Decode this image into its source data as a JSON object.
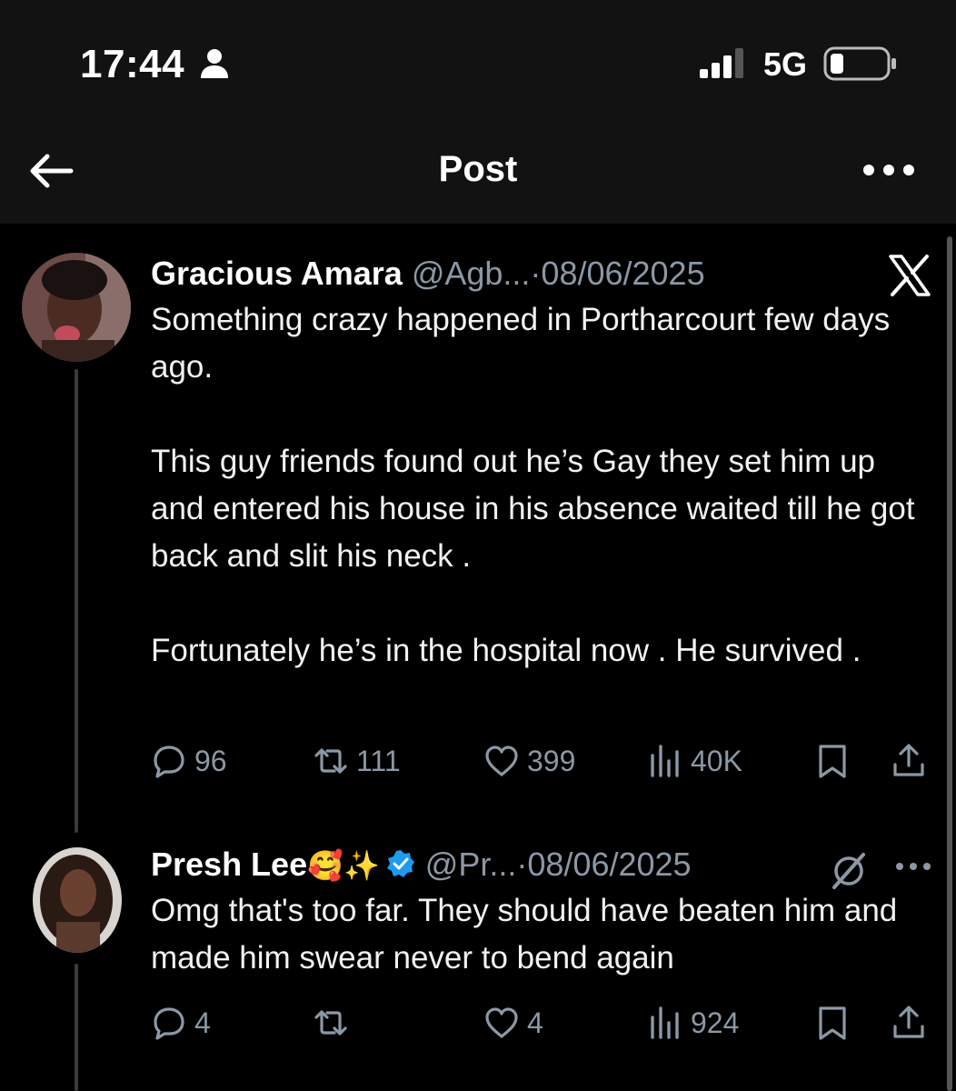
{
  "status_bar": {
    "time": "17:44",
    "network": "5G"
  },
  "nav": {
    "title": "Post"
  },
  "post": {
    "author_name": "Gracious Amara",
    "handle": "@Agb...",
    "separator": "·",
    "date": "08/06/2025",
    "text": "Something crazy happened in Portharcourt few days ago.\n\nThis guy friends found out he’s Gay they set him up and entered his house in his absence waited till he got back and slit his neck .\n\nFortunately he’s in the hospital now . He survived .",
    "replies": "96",
    "reposts": "111",
    "likes": "399",
    "views": "40K"
  },
  "reply": {
    "author_name": "Presh Lee",
    "emoji": "🥰✨",
    "handle": "@Pr...",
    "separator": "·",
    "date": "08/06/2025",
    "text": "Omg that's too far. They should have beaten him and made him swear never to bend again",
    "replies": "4",
    "reposts": "",
    "likes": "4",
    "views": "924"
  },
  "colors": {
    "background": "#000000",
    "bar": "#121212",
    "muted": "#8b98a5",
    "verified": "#1d9bf0"
  },
  "icons": [
    "person-icon",
    "signal-icon",
    "battery-icon",
    "back-arrow-icon",
    "more-icon",
    "x-logo-icon",
    "grok-icon",
    "reply-icon",
    "repost-icon",
    "like-icon",
    "views-icon",
    "bookmark-icon",
    "share-icon",
    "verified-badge-icon"
  ]
}
